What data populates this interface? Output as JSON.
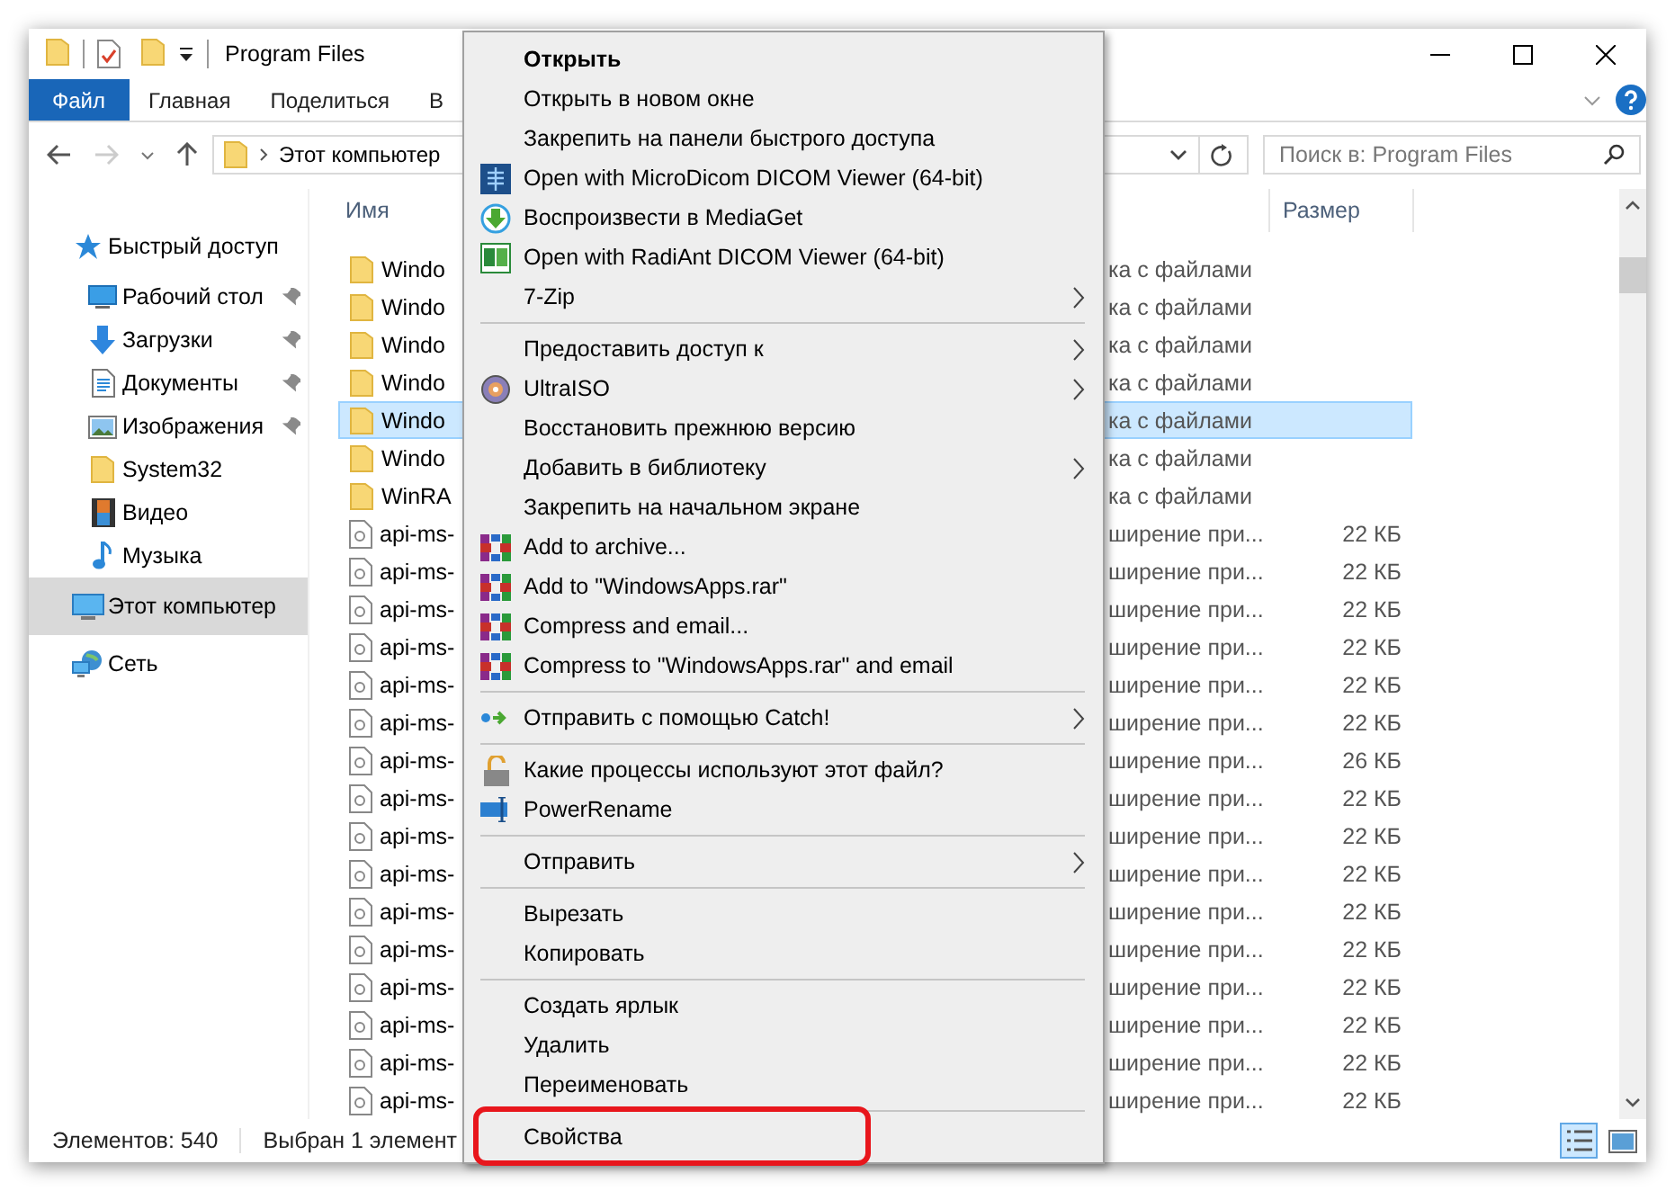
{
  "window": {
    "title": "Program Files"
  },
  "ribbon_tabs": [
    {
      "label": "Файл",
      "selected": true
    },
    {
      "label": "Главная",
      "selected": false
    },
    {
      "label": "Поделиться",
      "selected": false
    },
    {
      "label": "В",
      "selected": false
    }
  ],
  "address_bar": {
    "path": "Этот компьютер"
  },
  "search": {
    "placeholder": "Поиск в: Program Files"
  },
  "sidebar": {
    "items": [
      {
        "label": "Быстрый доступ",
        "selected": false,
        "children": [
          {
            "label": "Рабочий стол",
            "pinned": true,
            "selected": false
          },
          {
            "label": "Загрузки",
            "pinned": true,
            "selected": false
          },
          {
            "label": "Документы",
            "pinned": true,
            "selected": false
          },
          {
            "label": "Изображения",
            "pinned": true,
            "selected": false
          },
          {
            "label": "System32",
            "pinned": false,
            "selected": false
          },
          {
            "label": "Видео",
            "pinned": false,
            "selected": false
          },
          {
            "label": "Музыка",
            "pinned": false,
            "selected": false
          }
        ]
      },
      {
        "label": "Этот компьютер",
        "selected": true
      },
      {
        "label": "Сеть",
        "selected": false
      }
    ]
  },
  "table": {
    "columns": [
      {
        "label": "Имя"
      },
      {
        "label": "Размер"
      }
    ],
    "rows": [
      {
        "kind": "folder",
        "name": "Windo",
        "type": "ка с файлами",
        "selected": false
      },
      {
        "kind": "folder",
        "name": "Windo",
        "type": "ка с файлами",
        "selected": false
      },
      {
        "kind": "folder",
        "name": "Windo",
        "type": "ка с файлами",
        "selected": false
      },
      {
        "kind": "folder",
        "name": "Windo",
        "type": "ка с файлами",
        "selected": false
      },
      {
        "kind": "folder",
        "name": "Windo",
        "type": "ка с файлами",
        "selected": true
      },
      {
        "kind": "folder",
        "name": "Windo",
        "type": "ка с файлами",
        "selected": false
      },
      {
        "kind": "folder",
        "name": "WinRA",
        "type": "ка с файлами",
        "selected": false
      },
      {
        "kind": "file",
        "name": "api-ms-",
        "type": "ширение при...",
        "size": "22 КБ",
        "selected": false
      },
      {
        "kind": "file",
        "name": "api-ms-",
        "type": "ширение при...",
        "size": "22 КБ",
        "selected": false
      },
      {
        "kind": "file",
        "name": "api-ms-",
        "type": "ширение при...",
        "size": "22 КБ",
        "selected": false
      },
      {
        "kind": "file",
        "name": "api-ms-",
        "type": "ширение при...",
        "size": "22 КБ",
        "selected": false
      },
      {
        "kind": "file",
        "name": "api-ms-",
        "type": "ширение при...",
        "size": "22 КБ",
        "selected": false
      },
      {
        "kind": "file",
        "name": "api-ms-",
        "type": "ширение при...",
        "size": "22 КБ",
        "selected": false
      },
      {
        "kind": "file",
        "name": "api-ms-",
        "type": "ширение при...",
        "size": "26 КБ",
        "selected": false
      },
      {
        "kind": "file",
        "name": "api-ms-",
        "type": "ширение при...",
        "size": "22 КБ",
        "selected": false
      },
      {
        "kind": "file",
        "name": "api-ms-",
        "type": "ширение при...",
        "size": "22 КБ",
        "selected": false
      },
      {
        "kind": "file",
        "name": "api-ms-",
        "type": "ширение при...",
        "size": "22 КБ",
        "selected": false
      },
      {
        "kind": "file",
        "name": "api-ms-",
        "type": "ширение при...",
        "size": "22 КБ",
        "selected": false
      },
      {
        "kind": "file",
        "name": "api-ms-",
        "type": "ширение при...",
        "size": "22 КБ",
        "selected": false
      },
      {
        "kind": "file",
        "name": "api-ms-",
        "type": "ширение при...",
        "size": "22 КБ",
        "selected": false
      },
      {
        "kind": "file",
        "name": "api-ms-",
        "type": "ширение при...",
        "size": "22 КБ",
        "selected": false
      },
      {
        "kind": "file",
        "name": "api-ms-",
        "type": "ширение при...",
        "size": "22 КБ",
        "selected": false
      },
      {
        "kind": "file",
        "name": "api-ms-",
        "type": "ширение при...",
        "size": "22 КБ",
        "selected": false
      }
    ]
  },
  "context_menu": {
    "items": [
      {
        "kind": "item",
        "label": "Открыть",
        "default": true
      },
      {
        "kind": "item",
        "label": "Открыть в новом окне"
      },
      {
        "kind": "item",
        "label": "Закрепить на панели быстрого доступа"
      },
      {
        "kind": "item",
        "label": "Open with MicroDicom DICOM Viewer (64-bit)"
      },
      {
        "kind": "item",
        "label": "Воспроизвести в MediaGet"
      },
      {
        "kind": "item",
        "label": "Open with RadiAnt DICOM Viewer (64-bit)"
      },
      {
        "kind": "item",
        "label": "7-Zip",
        "submenu": true
      },
      {
        "kind": "separator"
      },
      {
        "kind": "item",
        "label": "Предоставить доступ к",
        "submenu": true
      },
      {
        "kind": "item",
        "label": "UltraISO",
        "submenu": true
      },
      {
        "kind": "item",
        "label": "Восстановить прежнюю версию"
      },
      {
        "kind": "item",
        "label": "Добавить в библиотеку",
        "submenu": true
      },
      {
        "kind": "item",
        "label": "Закрепить на начальном экране"
      },
      {
        "kind": "item",
        "label": "Add to archive..."
      },
      {
        "kind": "item",
        "label": "Add to \"WindowsApps.rar\""
      },
      {
        "kind": "item",
        "label": "Compress and email..."
      },
      {
        "kind": "item",
        "label": "Compress to \"WindowsApps.rar\" and email"
      },
      {
        "kind": "separator"
      },
      {
        "kind": "item",
        "label": "Отправить с помощью Catch!",
        "submenu": true
      },
      {
        "kind": "separator"
      },
      {
        "kind": "item",
        "label": "Какие процессы используют этот файл?"
      },
      {
        "kind": "item",
        "label": "PowerRename"
      },
      {
        "kind": "separator"
      },
      {
        "kind": "item",
        "label": "Отправить",
        "submenu": true
      },
      {
        "kind": "separator"
      },
      {
        "kind": "item",
        "label": "Вырезать"
      },
      {
        "kind": "item",
        "label": "Копировать"
      },
      {
        "kind": "separator"
      },
      {
        "kind": "item",
        "label": "Создать ярлык"
      },
      {
        "kind": "item",
        "label": "Удалить"
      },
      {
        "kind": "item",
        "label": "Переименовать"
      },
      {
        "kind": "separator"
      },
      {
        "kind": "item",
        "label": "Свойства",
        "marked": true
      }
    ]
  },
  "status_bar": {
    "count": "Элементов: 540",
    "selection": "Выбран 1 элемент",
    "views": [
      {
        "kind": "details",
        "selected": true
      },
      {
        "kind": "large",
        "selected": false
      }
    ]
  }
}
